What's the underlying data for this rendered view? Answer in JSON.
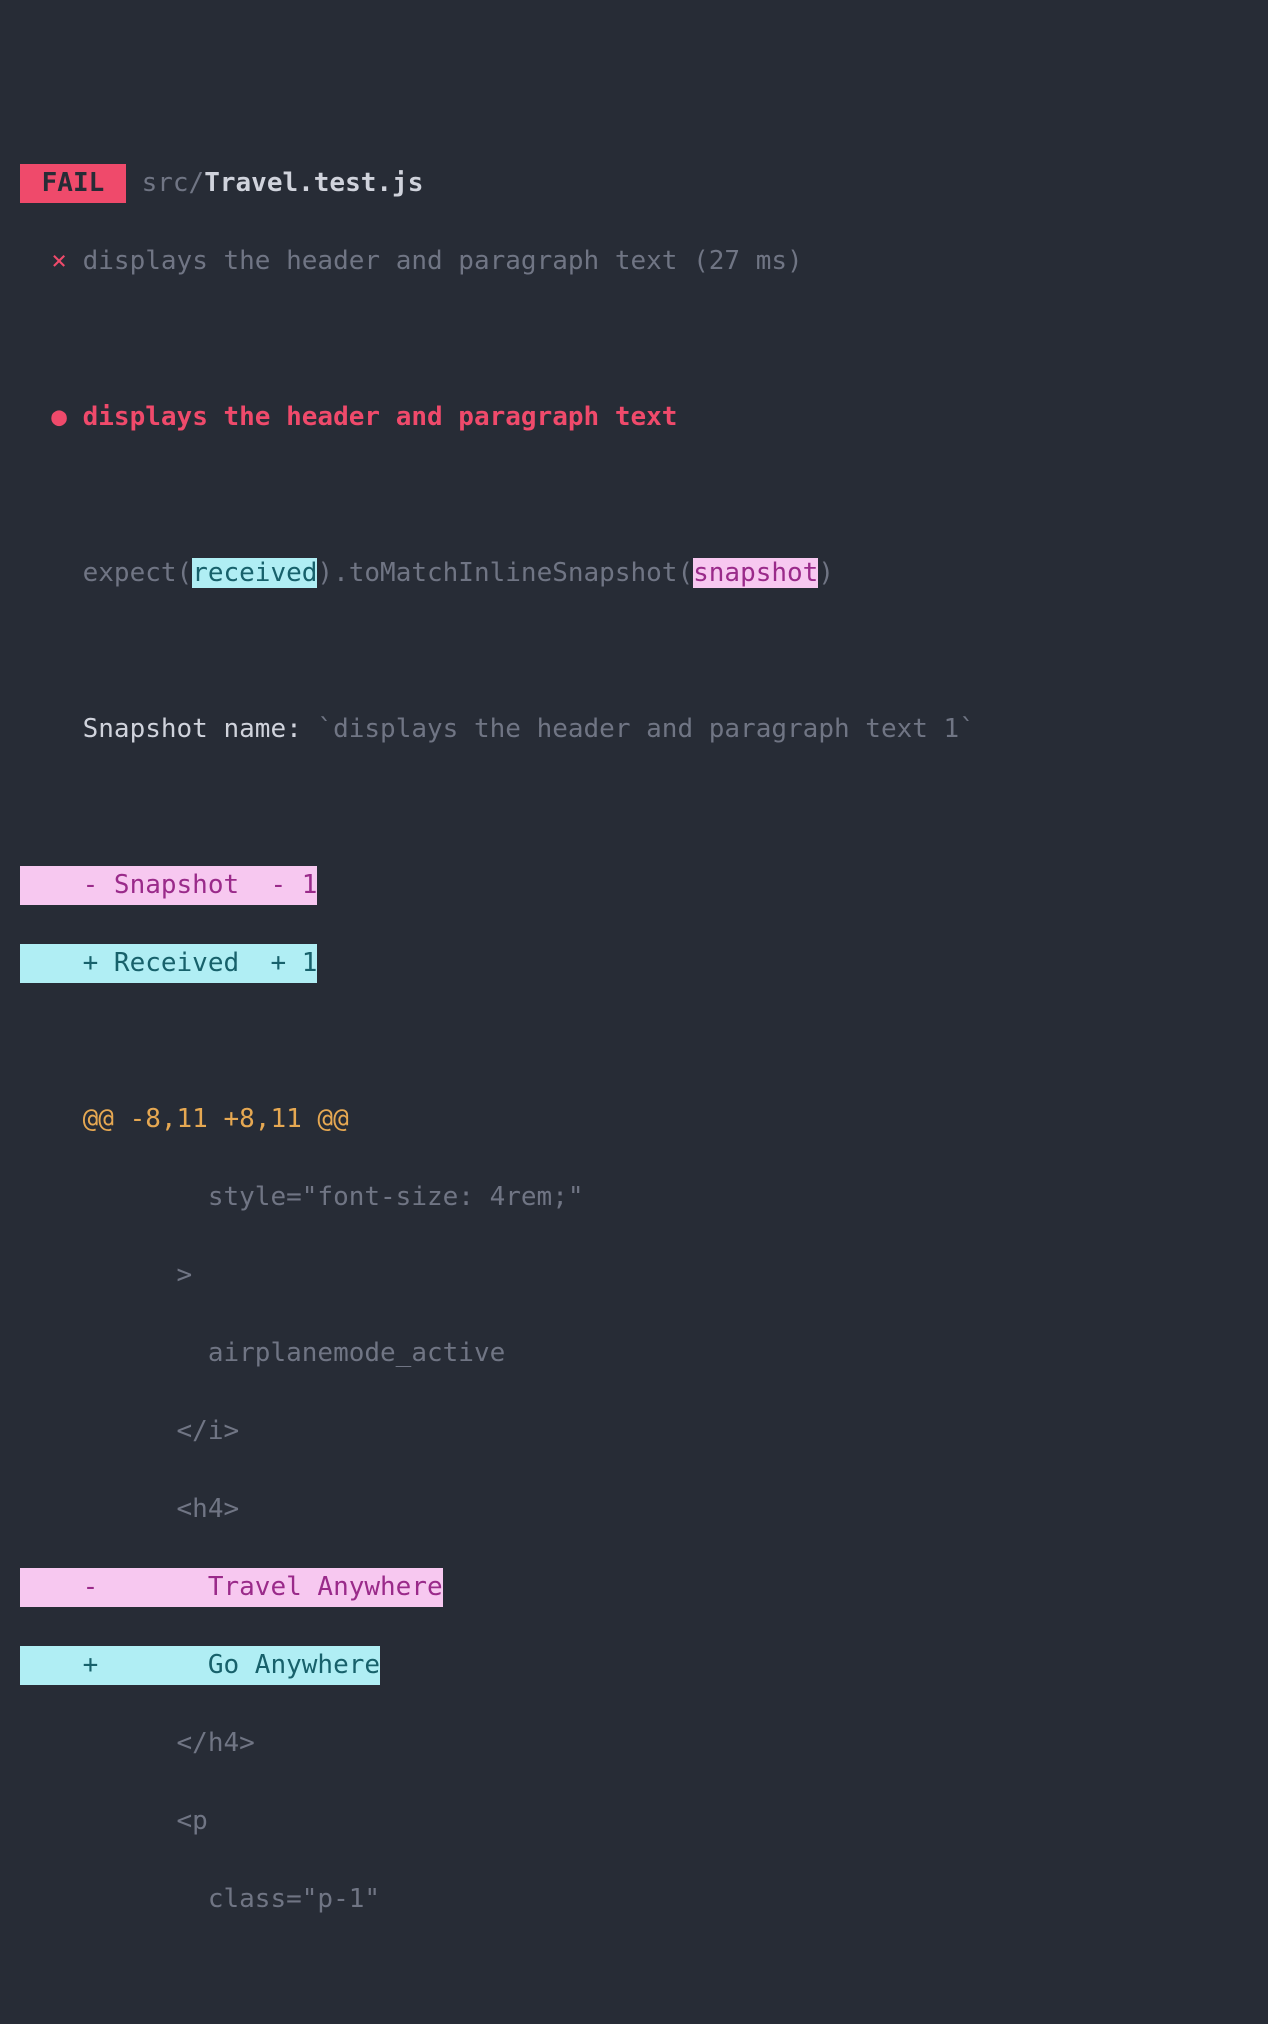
{
  "badge": " FAIL ",
  "path_prefix": " src/",
  "path_file": "Travel.test.js",
  "summary_x": "  ×",
  "summary": " displays the header and paragraph text (27 ms)",
  "title_bullet": "  ●",
  "title": " displays the header and paragraph text",
  "expect": {
    "pre": "    expect(",
    "received": "received",
    "mid": ").toMatchInlineSnapshot(",
    "snapshot": "snapshot",
    "end": ")"
  },
  "snapname_label": "    Snapshot name: ",
  "snapname_value": "`displays the header and paragraph text 1`",
  "legend_snap": "    - Snapshot  - 1",
  "legend_recv": "    + Received  + 1",
  "hunk": "    @@ -8,11 +8,11 @@",
  "ctx1": "            style=\"font-size: 4rem;\"",
  "ctx2": "          >",
  "ctx3": "            airplanemode_active",
  "ctx4": "          </i>",
  "ctx5": "          <h4>",
  "diff_minus": "    -       Travel Anywhere",
  "diff_plus": "    +       Go Anywhere",
  "ctx6": "          </h4>",
  "ctx7": "          <p",
  "ctx8": "            class=\"p-1\""
}
